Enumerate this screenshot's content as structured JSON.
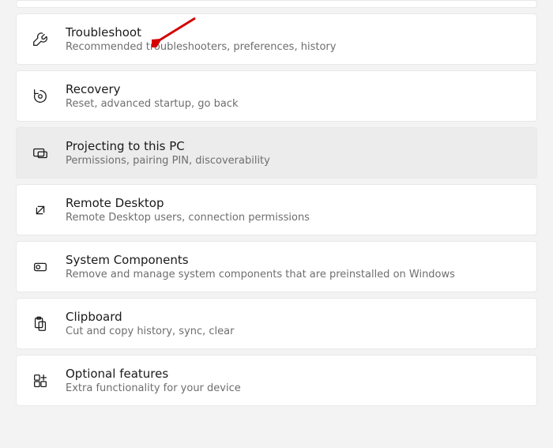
{
  "items": [
    {
      "id": "troubleshoot",
      "title": "Troubleshoot",
      "desc": "Recommended troubleshooters, preferences, history",
      "highlight": false
    },
    {
      "id": "recovery",
      "title": "Recovery",
      "desc": "Reset, advanced startup, go back",
      "highlight": false
    },
    {
      "id": "projecting",
      "title": "Projecting to this PC",
      "desc": "Permissions, pairing PIN, discoverability",
      "highlight": true
    },
    {
      "id": "remote-desktop",
      "title": "Remote Desktop",
      "desc": "Remote Desktop users, connection permissions",
      "highlight": false
    },
    {
      "id": "system-components",
      "title": "System Components",
      "desc": "Remove and manage system components that are preinstalled on Windows",
      "highlight": false
    },
    {
      "id": "clipboard",
      "title": "Clipboard",
      "desc": "Cut and copy history, sync, clear",
      "highlight": false
    },
    {
      "id": "optional-features",
      "title": "Optional features",
      "desc": "Extra functionality for your device",
      "highlight": false
    }
  ]
}
